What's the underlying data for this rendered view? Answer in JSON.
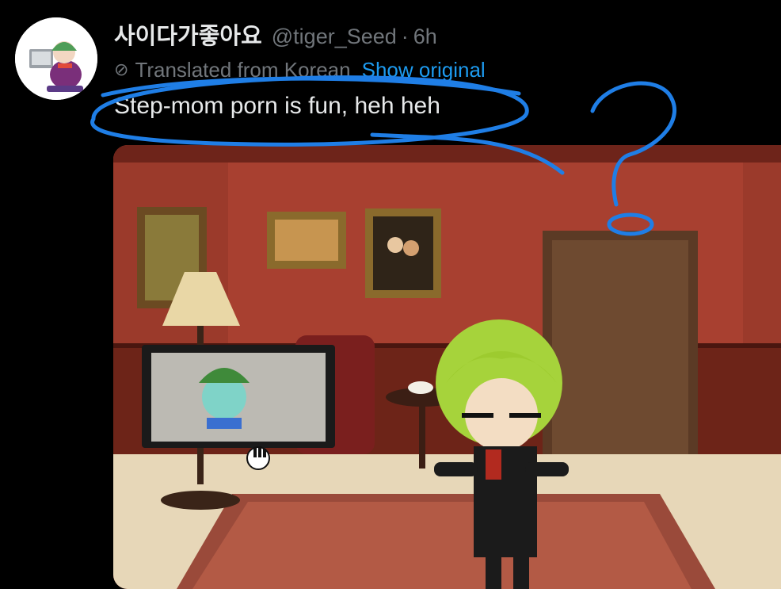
{
  "tweet": {
    "display_name": "사이다가좋아요",
    "handle": "@tiger_Seed",
    "separator": "·",
    "time": "6h",
    "translated_note": "Translated from Korean",
    "show_original_label": "Show original",
    "text": "Step-mom porn is fun, heh heh"
  },
  "icons": {
    "translate": "translate-icon",
    "hand_cursor": "hand-cursor-icon",
    "question_mark": "question-mark-annotation"
  },
  "colors": {
    "background": "#000000",
    "text_primary": "#e7e9ea",
    "text_secondary": "#71767b",
    "link_blue": "#1d9bf0",
    "annotation_blue": "#1f7ee6"
  }
}
